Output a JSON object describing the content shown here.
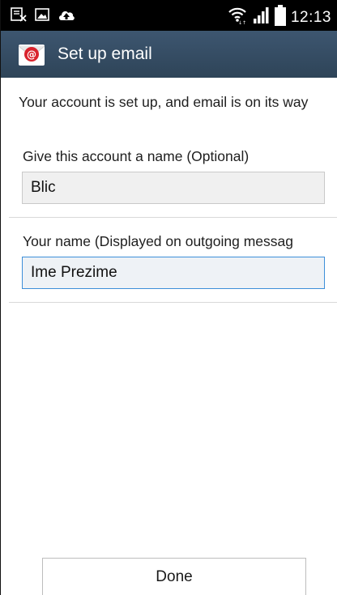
{
  "status_bar": {
    "time": "12:13",
    "icons": [
      "blocked-notification-icon",
      "image-icon",
      "cloud-upload-icon",
      "wifi-icon",
      "signal-icon",
      "battery-icon"
    ]
  },
  "action_bar": {
    "title": "Set up email",
    "icon": "email-app-icon",
    "color": "#34495e"
  },
  "main": {
    "intro_text": "Your account is set up, and email is on its way",
    "account_name": {
      "label": "Give this account a name (Optional)",
      "value": "Blic"
    },
    "your_name": {
      "label": "Your name (Displayed on outgoing messag",
      "value": "Ime Prezime"
    }
  },
  "footer": {
    "done_label": "Done"
  }
}
